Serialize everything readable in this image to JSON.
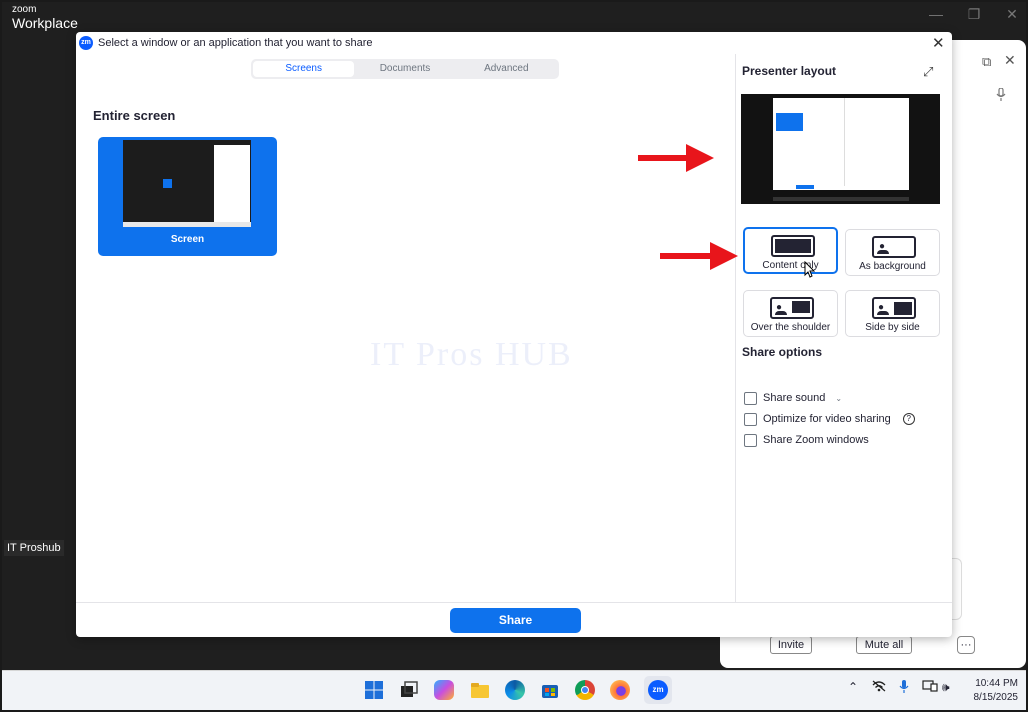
{
  "app": {
    "brand_small": "zoom",
    "brand_big": "Workplace"
  },
  "participant_tag": "IT Proshub",
  "participants_panel": {
    "invite_label": "Invite",
    "mute_all_label": "Mute all",
    "more_label": "···"
  },
  "dialog": {
    "title": "Select a window or an application that you want to share",
    "tabs": [
      {
        "label": "Screens",
        "active": true
      },
      {
        "label": "Documents",
        "active": false
      },
      {
        "label": "Advanced",
        "active": false
      }
    ],
    "section_title": "Entire screen",
    "screen_item_label": "Screen",
    "watermark": "IT Pros HUB",
    "presenter_layout": {
      "title": "Presenter layout",
      "options": [
        {
          "label": "Content only",
          "selected": true
        },
        {
          "label": "As background",
          "selected": false
        },
        {
          "label": "Over the shoulder",
          "selected": false
        },
        {
          "label": "Side by side",
          "selected": false
        }
      ]
    },
    "share_options": {
      "title": "Share options",
      "items": [
        {
          "label": "Share sound",
          "checked": false
        },
        {
          "label": "Optimize for video sharing",
          "checked": false
        },
        {
          "label": "Share Zoom windows",
          "checked": false
        }
      ]
    },
    "share_button_label": "Share"
  },
  "taskbar": {
    "time": "10:44 PM",
    "date": "8/15/2025"
  },
  "colors": {
    "accent": "#0e72ed",
    "annotation_arrow": "#e8151b"
  }
}
